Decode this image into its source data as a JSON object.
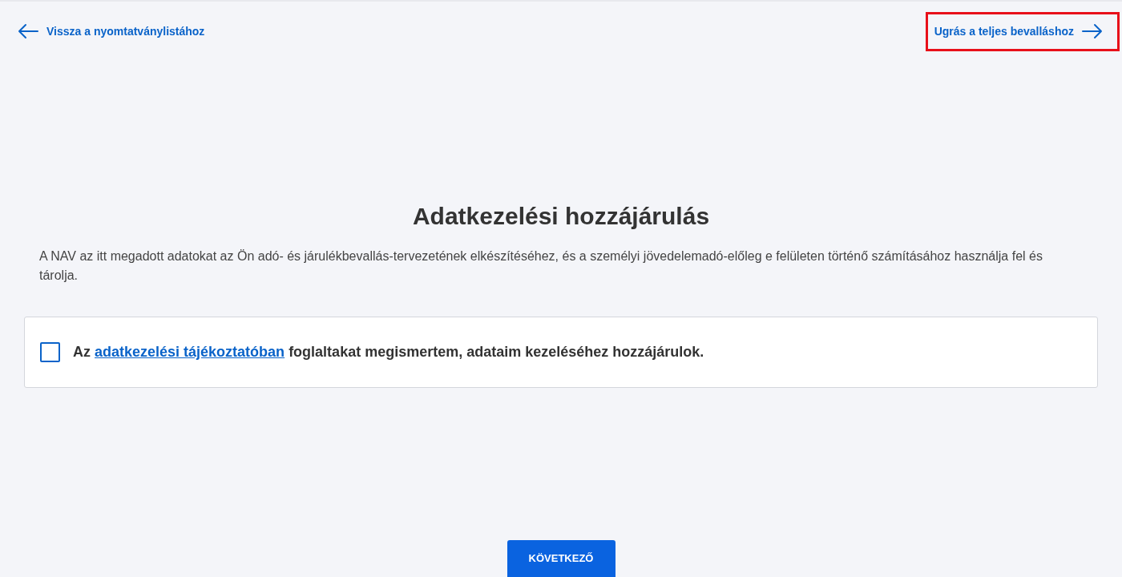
{
  "nav": {
    "back_link": "Vissza a nyomtatványlistához",
    "forward_link": {
      "label": "Ugrás a teljes bevalláshoz",
      "highlighted": true
    }
  },
  "title": "Adatkezelési hozzájárulás",
  "description": "A NAV az itt megadott adatokat az Ön adó- és járulékbevallás-tervezetének elkészítéséhez, és a személyi jövedelemadó-előleg e felületen történő számításához használja fel és tárolja.",
  "consent": {
    "checked": false,
    "text_before": "Az",
    "link": "adatkezelési tájékoztatóban",
    "text_after": "foglaltakat megismertem, adataim kezeléséhez hozzájárulok."
  },
  "next_button": "KÖVETKEZŐ"
}
